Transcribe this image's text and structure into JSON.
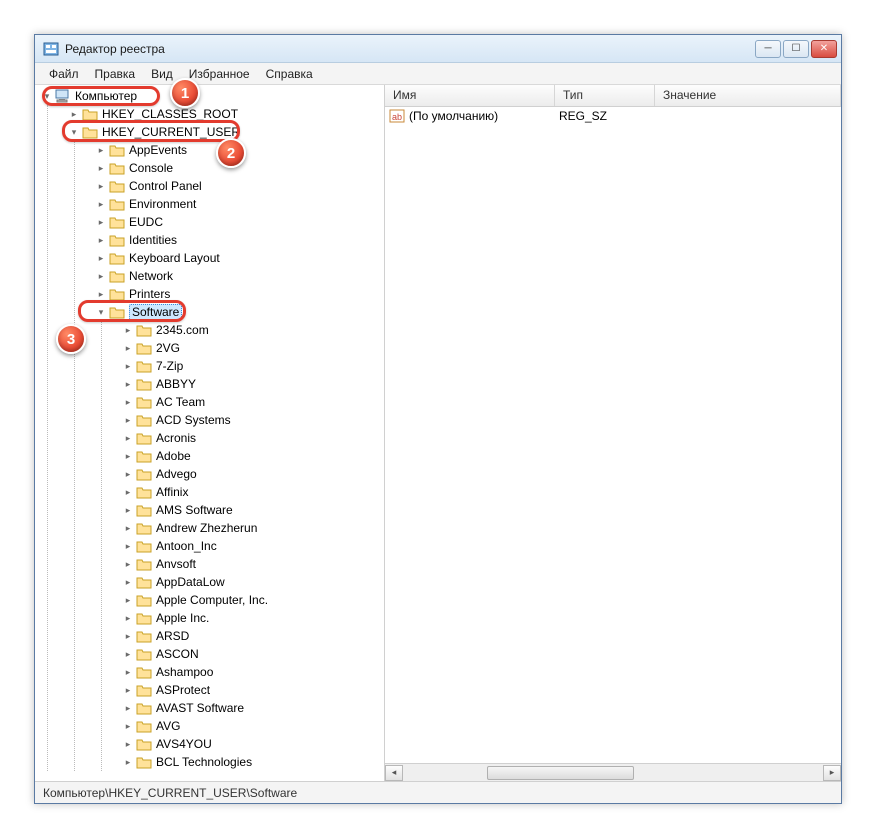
{
  "window": {
    "title": "Редактор реестра"
  },
  "menu": {
    "file": "Файл",
    "edit": "Правка",
    "view": "Вид",
    "favorites": "Избранное",
    "help": "Справка"
  },
  "tree": {
    "root": "Компьютер",
    "hkcr": "HKEY_CLASSES_ROOT",
    "hkcu": "HKEY_CURRENT_USER",
    "hkcu_children": [
      "AppEvents",
      "Console",
      "Control Panel",
      "Environment",
      "EUDC",
      "Identities",
      "Keyboard Layout",
      "Network",
      "Printers"
    ],
    "software": "Software",
    "software_children_first": "2345.com",
    "software_children": [
      "2VG",
      "7-Zip",
      "ABBYY",
      "AC Team",
      "ACD Systems",
      "Acronis",
      "Adobe",
      "Advego",
      "Affinix",
      "AMS Software",
      "Andrew Zhezherun",
      "Antoon_Inc",
      "Anvsoft",
      "AppDataLow",
      "Apple Computer, Inc.",
      "Apple Inc.",
      "ARSD",
      "ASCON",
      "Ashampoo",
      "ASProtect",
      "AVAST Software",
      "AVG",
      "AVS4YOU",
      "BCL Technologies"
    ]
  },
  "list": {
    "columns": {
      "name": "Имя",
      "type": "Тип",
      "data": "Значение"
    },
    "rows": [
      {
        "name": "(По умолчанию)",
        "type": "REG_SZ",
        "data": ""
      }
    ]
  },
  "status": "Компьютер\\HKEY_CURRENT_USER\\Software",
  "callouts": {
    "b1": "1",
    "b2": "2",
    "b3": "3"
  }
}
